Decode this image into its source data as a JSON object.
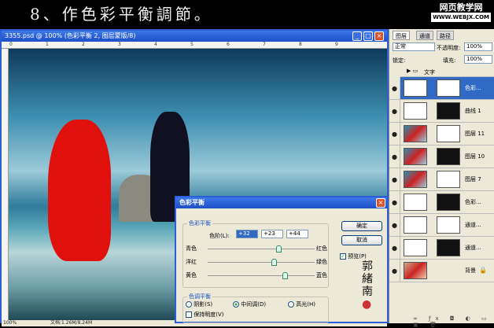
{
  "step_title": "8、作色彩平衡調節。",
  "logo": {
    "text": "网页教学网",
    "sub": "WWW.WEBJX.COM"
  },
  "document": {
    "title": "3355.psd @ 100% (色彩平衡 2, 图层蒙版/8)",
    "ruler_ticks": [
      "0",
      "1",
      "2",
      "3",
      "4",
      "5",
      "6",
      "7",
      "8",
      "9"
    ],
    "zoom": "100%",
    "doc_info": "文档:1.26M/8.24M"
  },
  "layers_panel": {
    "tabs": [
      "图层",
      "通道",
      "路径"
    ],
    "blend_mode": "正常",
    "opacity_label": "不透明度:",
    "opacity": "100%",
    "lock_label": "锁定:",
    "fill_label": "填充:",
    "fill": "100%",
    "group": "文字",
    "layers": [
      {
        "name": "色彩...",
        "type": "adjustment",
        "selected": true
      },
      {
        "name": "曲线 1",
        "type": "adjustment"
      },
      {
        "name": "图层 11",
        "type": "image"
      },
      {
        "name": "图层 10",
        "type": "image"
      },
      {
        "name": "图层 7",
        "type": "image"
      },
      {
        "name": "色彩...",
        "type": "adjustment"
      },
      {
        "name": "通道...",
        "type": "adjustment"
      },
      {
        "name": "通道...",
        "type": "adjustment"
      },
      {
        "name": "背景",
        "type": "background"
      }
    ]
  },
  "dialog": {
    "title": "色彩平衡",
    "group1": "色彩平衡",
    "levels_label": "色阶(L):",
    "levels": [
      "+32",
      "+23",
      "+44"
    ],
    "sliders": [
      {
        "left": "青色",
        "right": "红色",
        "value": 32
      },
      {
        "left": "洋红",
        "right": "绿色",
        "value": 23
      },
      {
        "left": "黄色",
        "right": "蓝色",
        "value": 44
      }
    ],
    "group2": "色调平衡",
    "tones": [
      "阴影(S)",
      "中间调(D)",
      "高光(H)"
    ],
    "selected_tone": "中间调(D)",
    "preserve": "保持明度(V)",
    "ok": "确定",
    "cancel": "取消",
    "preview": "预览(P)",
    "preview_checked": true
  }
}
